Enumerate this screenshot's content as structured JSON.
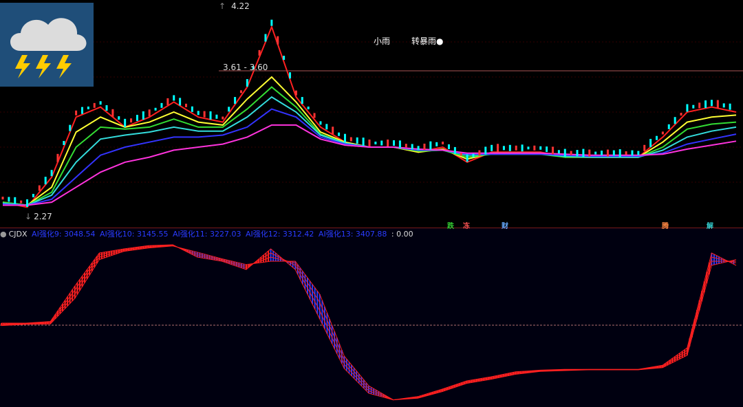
{
  "main_panel": {
    "price_high": "4.22",
    "price_low": "2.27",
    "price_range": "3.61 - 3.60",
    "weather_text_1": "小雨",
    "weather_text_2": "转暴雨●",
    "tags": [
      {
        "text": "跌",
        "color": "#33cc33"
      },
      {
        "text": "冻",
        "color": "#ff5555"
      },
      {
        "text": "财",
        "color": "#66aaff"
      },
      {
        "text": "腾",
        "color": "#ff8844"
      },
      {
        "text": "解",
        "color": "#33cccc"
      }
    ]
  },
  "sub_panel": {
    "indicator_name": "CJDX",
    "series": [
      {
        "label": "AI强化9: 3048.54",
        "color": "#2a3cff"
      },
      {
        "label": "AI强化10: 3145.55",
        "color": "#2a3cff"
      },
      {
        "label": "AI强化11: 3227.03",
        "color": "#2a3cff"
      },
      {
        "label": "AI强化12: 3312.42",
        "color": "#2a3cff"
      },
      {
        "label": "AI强化13: 3407.88",
        "color": "#2a3cff"
      }
    ],
    "tail_value": ": 0.00"
  },
  "icons": {
    "weather": "storm-cloud-lightning-icon"
  },
  "chart_data": [
    {
      "type": "line",
      "name": "price-main",
      "x": [
        0,
        1,
        2,
        3,
        4,
        5,
        6,
        7,
        8,
        9,
        10,
        11,
        12,
        13,
        14,
        15,
        16,
        17,
        18,
        19,
        20,
        21,
        22,
        23,
        24,
        25,
        26,
        27,
        28,
        29,
        30
      ],
      "series": [
        {
          "color": "#ff2020",
          "values": [
            2.35,
            2.3,
            2.6,
            3.2,
            3.3,
            3.1,
            3.2,
            3.35,
            3.2,
            3.15,
            3.5,
            4.1,
            3.4,
            3.1,
            2.95,
            2.9,
            2.9,
            2.85,
            2.9,
            2.75,
            2.85,
            2.85,
            2.85,
            2.8,
            2.8,
            2.8,
            2.8,
            3.0,
            3.25,
            3.3,
            3.25
          ]
        },
        {
          "color": "#ffff33",
          "values": [
            2.35,
            2.32,
            2.5,
            3.05,
            3.2,
            3.1,
            3.15,
            3.25,
            3.15,
            3.12,
            3.38,
            3.6,
            3.35,
            3.05,
            2.95,
            2.9,
            2.9,
            2.85,
            2.88,
            2.78,
            2.84,
            2.84,
            2.84,
            2.8,
            2.8,
            2.8,
            2.8,
            2.95,
            3.15,
            3.2,
            3.22
          ]
        },
        {
          "color": "#33dd33",
          "values": [
            2.35,
            2.32,
            2.45,
            2.9,
            3.1,
            3.08,
            3.1,
            3.18,
            3.1,
            3.1,
            3.28,
            3.5,
            3.3,
            3.03,
            2.94,
            2.9,
            2.9,
            2.86,
            2.87,
            2.8,
            2.83,
            2.83,
            2.83,
            2.8,
            2.8,
            2.8,
            2.8,
            2.9,
            3.08,
            3.13,
            3.15
          ]
        },
        {
          "color": "#33dddd",
          "values": [
            2.34,
            2.32,
            2.42,
            2.75,
            2.98,
            3.02,
            3.05,
            3.1,
            3.06,
            3.06,
            3.2,
            3.4,
            3.25,
            3.02,
            2.94,
            2.9,
            2.9,
            2.87,
            2.87,
            2.82,
            2.83,
            2.83,
            2.83,
            2.81,
            2.8,
            2.8,
            2.8,
            2.87,
            3.0,
            3.06,
            3.1
          ]
        },
        {
          "color": "#3333ff",
          "values": [
            2.33,
            2.32,
            2.38,
            2.6,
            2.82,
            2.9,
            2.95,
            3.0,
            3.0,
            3.02,
            3.1,
            3.28,
            3.2,
            3.0,
            2.93,
            2.9,
            2.9,
            2.87,
            2.87,
            2.83,
            2.83,
            2.83,
            2.83,
            2.82,
            2.81,
            2.81,
            2.81,
            2.84,
            2.93,
            2.98,
            3.03
          ]
        },
        {
          "color": "#ff33dd",
          "values": [
            2.32,
            2.32,
            2.35,
            2.5,
            2.65,
            2.75,
            2.8,
            2.87,
            2.9,
            2.93,
            3.0,
            3.12,
            3.12,
            2.98,
            2.92,
            2.9,
            2.9,
            2.88,
            2.87,
            2.84,
            2.84,
            2.84,
            2.84,
            2.83,
            2.82,
            2.82,
            2.82,
            2.83,
            2.88,
            2.92,
            2.96
          ]
        }
      ],
      "ylim": [
        2.2,
        4.3
      ]
    },
    {
      "type": "line",
      "name": "cjdx-indicator",
      "x": [
        0,
        1,
        2,
        3,
        4,
        5,
        6,
        7,
        8,
        9,
        10,
        11,
        12,
        13,
        14,
        15,
        16,
        17,
        18,
        19,
        20,
        21,
        22,
        23,
        24,
        25,
        26,
        27,
        28,
        29,
        30
      ],
      "series": [
        {
          "color": "#ff2020",
          "values": [
            3450,
            3450,
            3470,
            3900,
            4300,
            4350,
            4390,
            4400,
            4250,
            4200,
            4100,
            4350,
            4100,
            3500,
            2900,
            2600,
            2520,
            2560,
            2650,
            2750,
            2800,
            2860,
            2880,
            2890,
            2890,
            2890,
            2890,
            2940,
            3150,
            4300,
            4150
          ]
        },
        {
          "color": "#ff2020",
          "values": [
            3440,
            3445,
            3460,
            3850,
            4280,
            4340,
            4380,
            4395,
            4270,
            4210,
            4120,
            4300,
            4150,
            3600,
            2950,
            2630,
            2520,
            2550,
            2640,
            2740,
            2790,
            2850,
            2875,
            2885,
            2888,
            2888,
            2888,
            2930,
            3120,
            4250,
            4180
          ]
        },
        {
          "color": "#ff2020",
          "values": [
            3430,
            3440,
            3450,
            3800,
            4250,
            4330,
            4370,
            4390,
            4290,
            4220,
            4140,
            4250,
            4180,
            3700,
            3000,
            2660,
            2520,
            2545,
            2630,
            2730,
            2780,
            2840,
            2870,
            2880,
            2886,
            2886,
            2886,
            2920,
            3090,
            4200,
            4200
          ]
        },
        {
          "color": "#ff2020",
          "values": [
            3420,
            3435,
            3440,
            3750,
            4220,
            4320,
            4360,
            4385,
            4310,
            4230,
            4160,
            4200,
            4200,
            3800,
            3050,
            2690,
            2520,
            2540,
            2620,
            2720,
            2770,
            2830,
            2865,
            2875,
            2884,
            2884,
            2884,
            2910,
            3060,
            4150,
            4220
          ]
        }
      ],
      "ylim": [
        2500,
        4450
      ]
    }
  ]
}
